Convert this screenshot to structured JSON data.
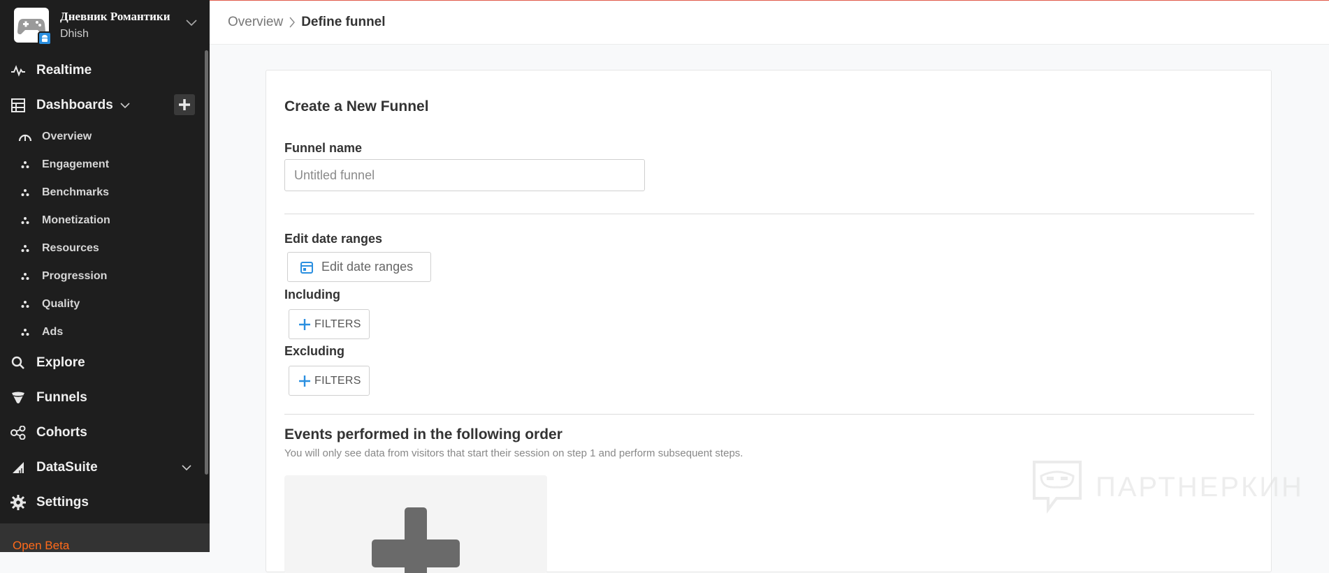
{
  "app": {
    "name": "Дневник Романтики",
    "user": "Dhish"
  },
  "sidebar": {
    "items": [
      {
        "label": "Realtime",
        "icon": "pulse-icon"
      },
      {
        "label": "Dashboards",
        "icon": "table-grid-icon"
      },
      {
        "label": "Explore",
        "icon": "search-icon"
      },
      {
        "label": "Funnels",
        "icon": "funnel-icon"
      },
      {
        "label": "Cohorts",
        "icon": "share-nodes-icon"
      },
      {
        "label": "DataSuite",
        "icon": "ruler-triangle-icon"
      },
      {
        "label": "Settings",
        "icon": "gear-icon"
      }
    ],
    "dashboards": [
      {
        "label": "Overview",
        "icon": "gauge-icon"
      },
      {
        "label": "Engagement",
        "icon": "dots-icon"
      },
      {
        "label": "Benchmarks",
        "icon": "dots-icon"
      },
      {
        "label": "Monetization",
        "icon": "dots-icon"
      },
      {
        "label": "Resources",
        "icon": "dots-icon"
      },
      {
        "label": "Progression",
        "icon": "dots-icon"
      },
      {
        "label": "Quality",
        "icon": "dots-icon"
      },
      {
        "label": "Ads",
        "icon": "dots-icon"
      }
    ],
    "footer": "Open Beta"
  },
  "breadcrumb": {
    "parent": "Overview",
    "current": "Define funnel"
  },
  "form": {
    "title": "Create a New Funnel",
    "name_label": "Funnel name",
    "name_placeholder": "Untitled funnel",
    "date_label": "Edit date ranges",
    "date_button": "Edit date ranges",
    "including_label": "Including",
    "excluding_label": "Excluding",
    "filters_button": "FILTERS",
    "events_title": "Events performed in the following order",
    "events_desc": "You will only see data from visitors that start their session on step 1 and perform subsequent steps."
  },
  "watermark": {
    "text": "ПАРТНЕРКИН"
  },
  "colors": {
    "sidebar_bg": "#1e1e1e",
    "accent_blue": "#2a8fe0",
    "beta_orange": "#ff6a1a"
  }
}
